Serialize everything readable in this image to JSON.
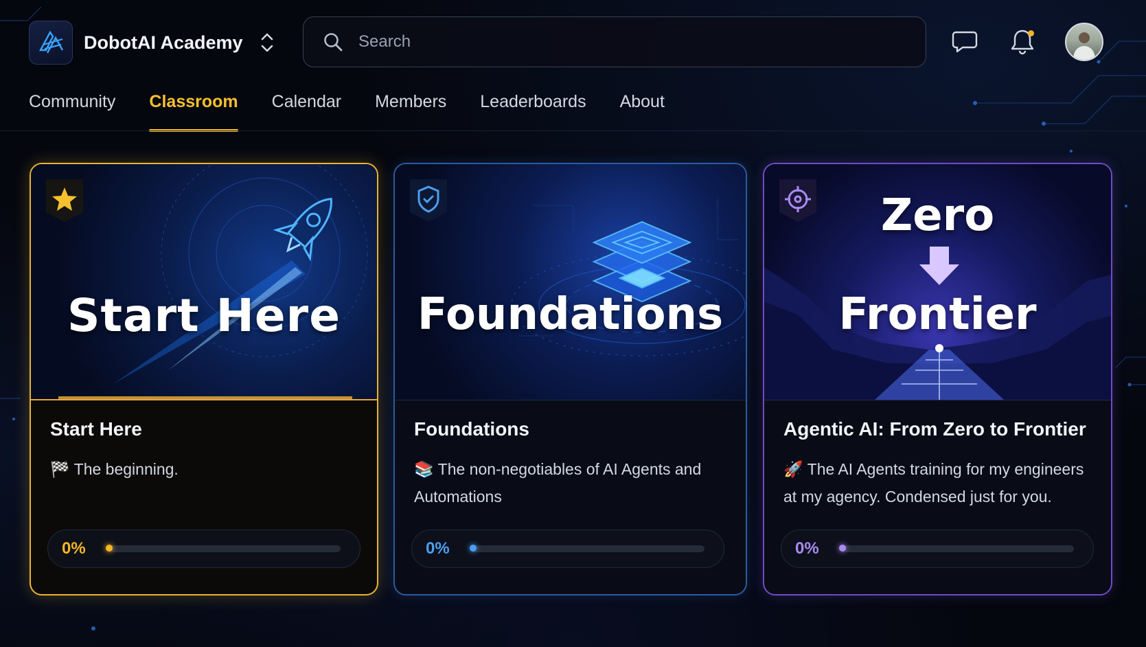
{
  "brand": {
    "name": "DobotAI Academy"
  },
  "search": {
    "placeholder": "Search"
  },
  "nav": {
    "items": [
      {
        "label": "Community",
        "active": false
      },
      {
        "label": "Classroom",
        "active": true
      },
      {
        "label": "Calendar",
        "active": false
      },
      {
        "label": "Members",
        "active": false
      },
      {
        "label": "Leaderboards",
        "active": false
      },
      {
        "label": "About",
        "active": false
      }
    ]
  },
  "header_icons": [
    "chat-icon",
    "bell-icon",
    "avatar"
  ],
  "notifications": {
    "has_unread": true
  },
  "colors": {
    "accent_gold": "#f6c02f",
    "accent_blue": "#4a9ff0",
    "accent_purple": "#a98af2",
    "background": "#05070f"
  },
  "courses": [
    {
      "badge_icon": "star-icon",
      "banner_title": "Start Here",
      "title": "Start Here",
      "emoji": "🏁",
      "description": "The beginning.",
      "progress_label": "0%",
      "progress": 0
    },
    {
      "badge_icon": "shield-check-icon",
      "banner_title": "Foundations",
      "title": "Foundations",
      "emoji": "📚",
      "description": "The non-negotiables of AI Agents and Automations",
      "progress_label": "0%",
      "progress": 0
    },
    {
      "badge_icon": "crosshair-icon",
      "banner_title_top": "Zero",
      "banner_title_bottom": "Frontier",
      "title": "Agentic AI: From Zero to Frontier",
      "emoji": "🚀",
      "description": "The AI Agents training for my engineers at my agency. Condensed just for you.",
      "progress_label": "0%",
      "progress": 0
    }
  ]
}
